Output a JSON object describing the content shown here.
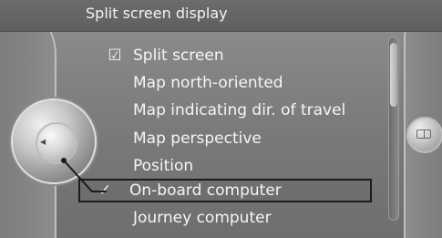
{
  "header": {
    "title": "Split screen display"
  },
  "menu": {
    "items": [
      {
        "label": "Split screen",
        "check": "☑"
      },
      {
        "label": "Map north-oriented",
        "check": ""
      },
      {
        "label": "Map indicating dir. of travel",
        "check": ""
      },
      {
        "label": "Map perspective",
        "check": ""
      },
      {
        "label": "Position",
        "check": ""
      },
      {
        "label": "On-board computer",
        "check": "✓"
      },
      {
        "label": "Journey computer",
        "check": ""
      }
    ],
    "selected_index": 5
  },
  "controls": {
    "left_knob_icon": "chevron-left-icon",
    "right_button_icon": "split-view-icon"
  },
  "colors": {
    "text": "#f5f5f5",
    "background": "#7a7a7a",
    "highlight_border": "#1b1b1b"
  }
}
